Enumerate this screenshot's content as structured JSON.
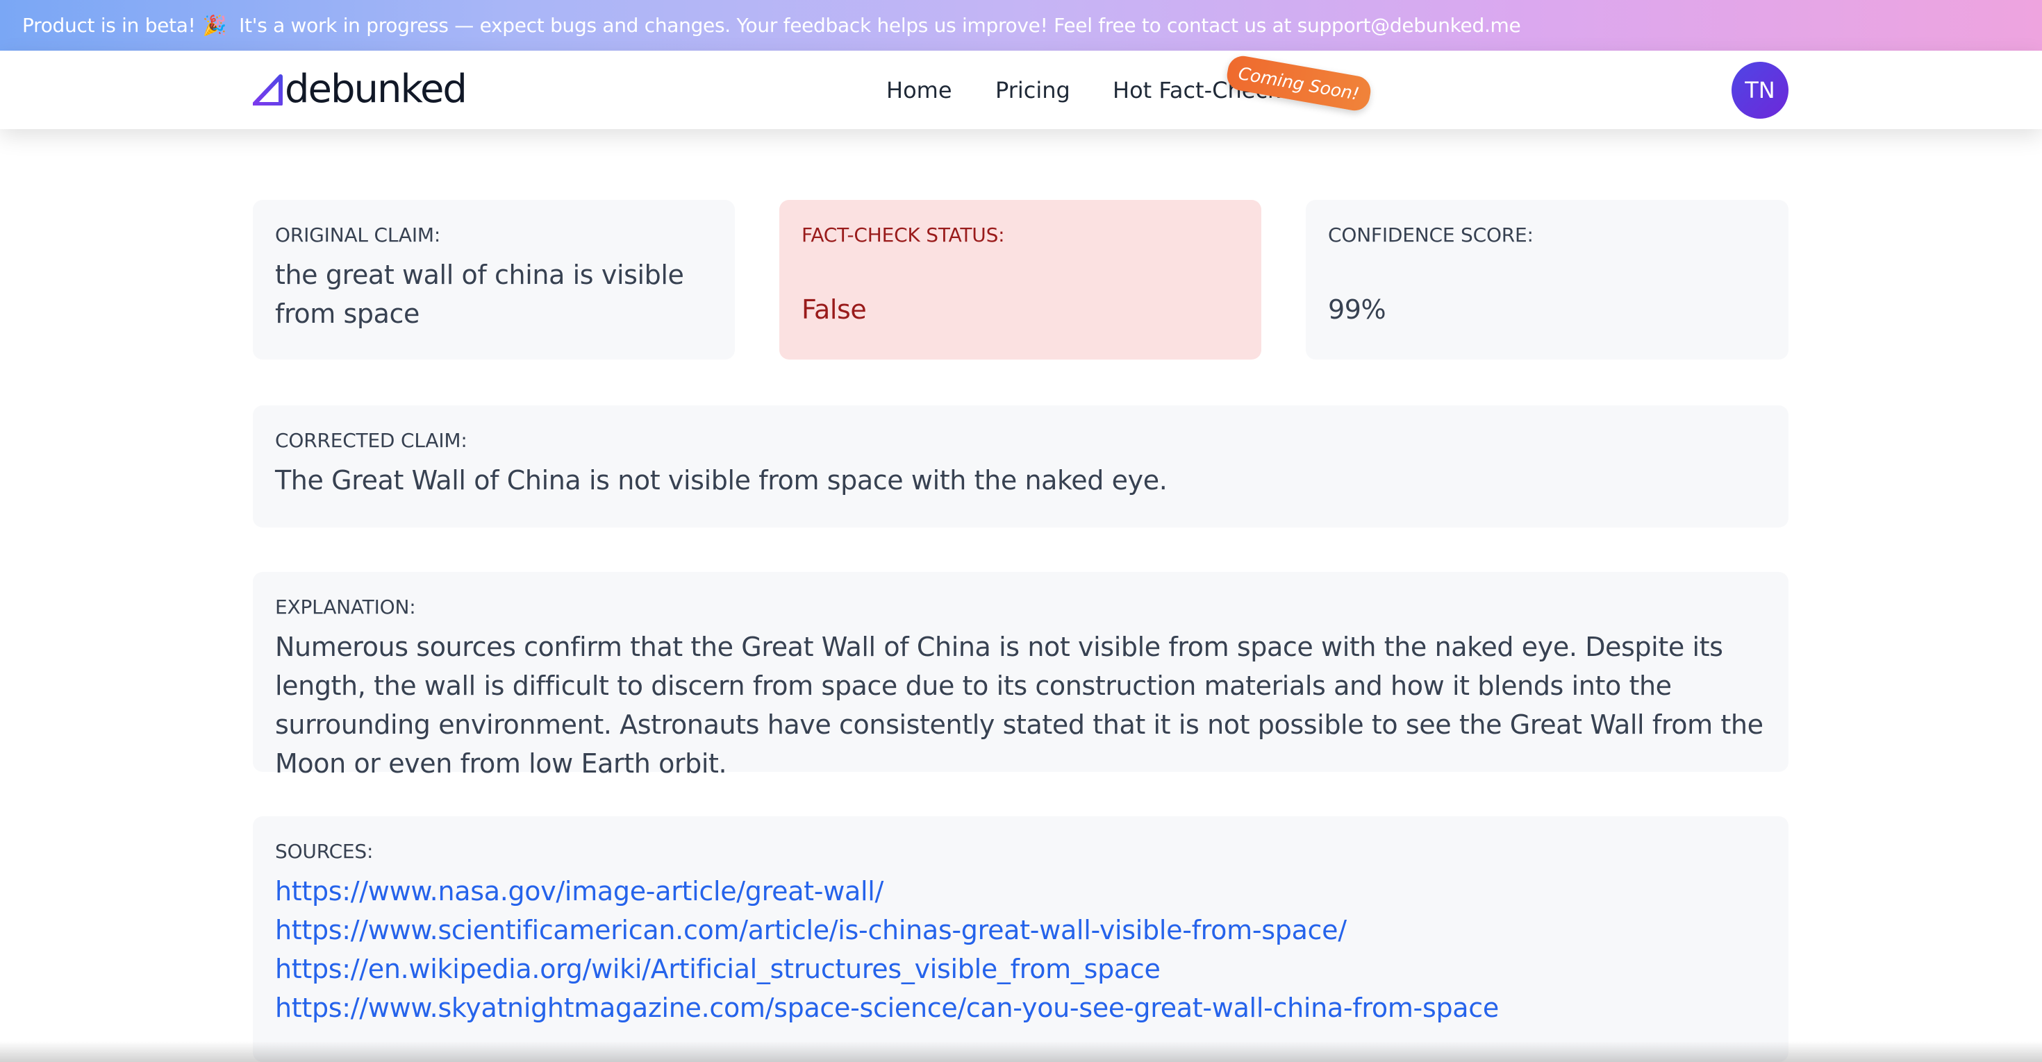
{
  "banner": {
    "text": "Product is in beta!",
    "emoji": "🎉",
    "message": "It's a work in progress — expect bugs and changes. Your feedback helps us improve! Feel free to contact us at support@debunked.me"
  },
  "header": {
    "logo_text": "debunked",
    "nav": [
      {
        "label": "Home"
      },
      {
        "label": "Pricing"
      },
      {
        "label": "Hot Fact-Checks"
      }
    ],
    "badge": "Coming Soon!",
    "avatar_initials": "TN"
  },
  "original_claim": {
    "label": "ORIGINAL CLAIM:",
    "value": "the great wall of china is visible from space"
  },
  "status": {
    "label": "FACT-CHECK STATUS:",
    "value": "False"
  },
  "confidence": {
    "label": "CONFIDENCE SCORE:",
    "value": "99%"
  },
  "corrected_claim": {
    "label": "CORRECTED CLAIM:",
    "value": "The Great Wall of China is not visible from space with the naked eye."
  },
  "explanation": {
    "label": "EXPLANATION:",
    "value": "Numerous sources confirm that the Great Wall of China is not visible from space with the naked eye. Despite its length, the wall is difficult to discern from space due to its construction materials and how it blends into the surrounding environment. Astronauts have consistently stated that it is not possible to see the Great Wall from the Moon or even from low Earth orbit."
  },
  "sources": {
    "label": "SOURCES:",
    "links": [
      "https://www.nasa.gov/image-article/great-wall/",
      "https://www.scientificamerican.com/article/is-chinas-great-wall-visible-from-space/",
      "https://en.wikipedia.org/wiki/Artificial_structures_visible_from_space",
      "https://www.skyatnightmagazine.com/space-science/can-you-see-great-wall-china-from-space"
    ]
  },
  "colors": {
    "link": "#2563eb",
    "status_bg": "#fbe1e1",
    "status_text": "#991b1b",
    "avatar": "#4f46e5",
    "badge": "#ef6a2e"
  }
}
